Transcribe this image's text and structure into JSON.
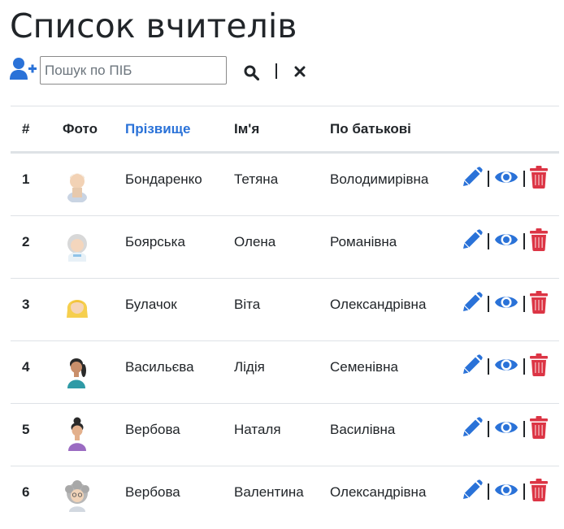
{
  "page": {
    "title": "Список вчителів"
  },
  "search": {
    "placeholder": "Пошук по ПІБ",
    "value": "",
    "separator": "|"
  },
  "colors": {
    "primary": "#2a72d8",
    "danger": "#dc3545",
    "text": "#212529",
    "border": "#dee2e6"
  },
  "icons": {
    "add": "user-plus-icon",
    "search": "search-icon",
    "clear": "close-icon",
    "edit": "pencil-icon",
    "view": "eye-icon",
    "delete": "trash-icon"
  },
  "table": {
    "columns": [
      "#",
      "Фото",
      "Прізвище",
      "Ім'я",
      "По батькові"
    ],
    "sorted_column": "Прізвище",
    "rows": [
      {
        "num": "1",
        "surname": "Бондаренко",
        "name": "Тетяна",
        "patronymic": "Володимирівна",
        "photo": "woman-light-avatar"
      },
      {
        "num": "2",
        "surname": "Боярська",
        "name": "Олена",
        "patronymic": "Романівна",
        "photo": "grey-hair-avatar"
      },
      {
        "num": "3",
        "surname": "Булачок",
        "name": "Віта",
        "patronymic": "Олександрівна",
        "photo": "blonde-avatar"
      },
      {
        "num": "4",
        "surname": "Васильєва",
        "name": "Лідія",
        "patronymic": "Семенівна",
        "photo": "ponytail-avatar"
      },
      {
        "num": "5",
        "surname": "Вербова",
        "name": "Наталя",
        "patronymic": "Василівна",
        "photo": "bun-hair-avatar"
      },
      {
        "num": "6",
        "surname": "Вербова",
        "name": "Валентина",
        "patronymic": "Олександрівна",
        "photo": "curly-grey-avatar"
      }
    ]
  }
}
